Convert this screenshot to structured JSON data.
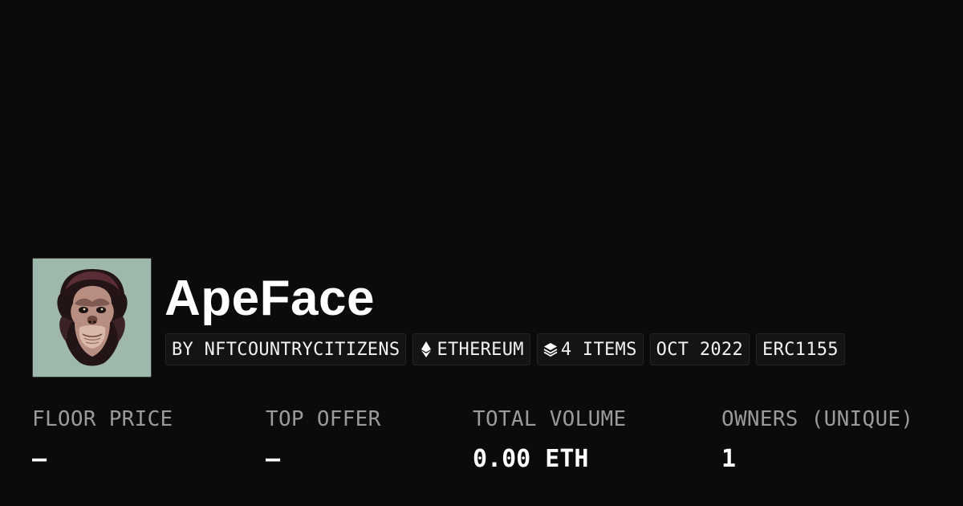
{
  "collection": {
    "name": "ApeFace",
    "avatar_alt": "Ape face artwork"
  },
  "tags": [
    {
      "label": "BY NFTCOUNTRYCITIZENS",
      "icon": ""
    },
    {
      "label": "ETHEREUM",
      "icon": "ethereum-icon"
    },
    {
      "label": "4 ITEMS",
      "icon": "layers-icon"
    },
    {
      "label": "OCT 2022",
      "icon": ""
    },
    {
      "label": "ERC1155",
      "icon": ""
    }
  ],
  "stats": [
    {
      "label": "FLOOR PRICE",
      "value": "–"
    },
    {
      "label": "TOP OFFER",
      "value": "–"
    },
    {
      "label": "TOTAL VOLUME",
      "value": "0.00 ETH"
    },
    {
      "label": "OWNERS (UNIQUE)",
      "value": "1"
    }
  ],
  "colors": {
    "background": "#0b0b0b",
    "text": "#ffffff",
    "muted": "#9a9a9a",
    "tag_bg": "#141414",
    "avatar_bg": "#9fb8ac"
  }
}
